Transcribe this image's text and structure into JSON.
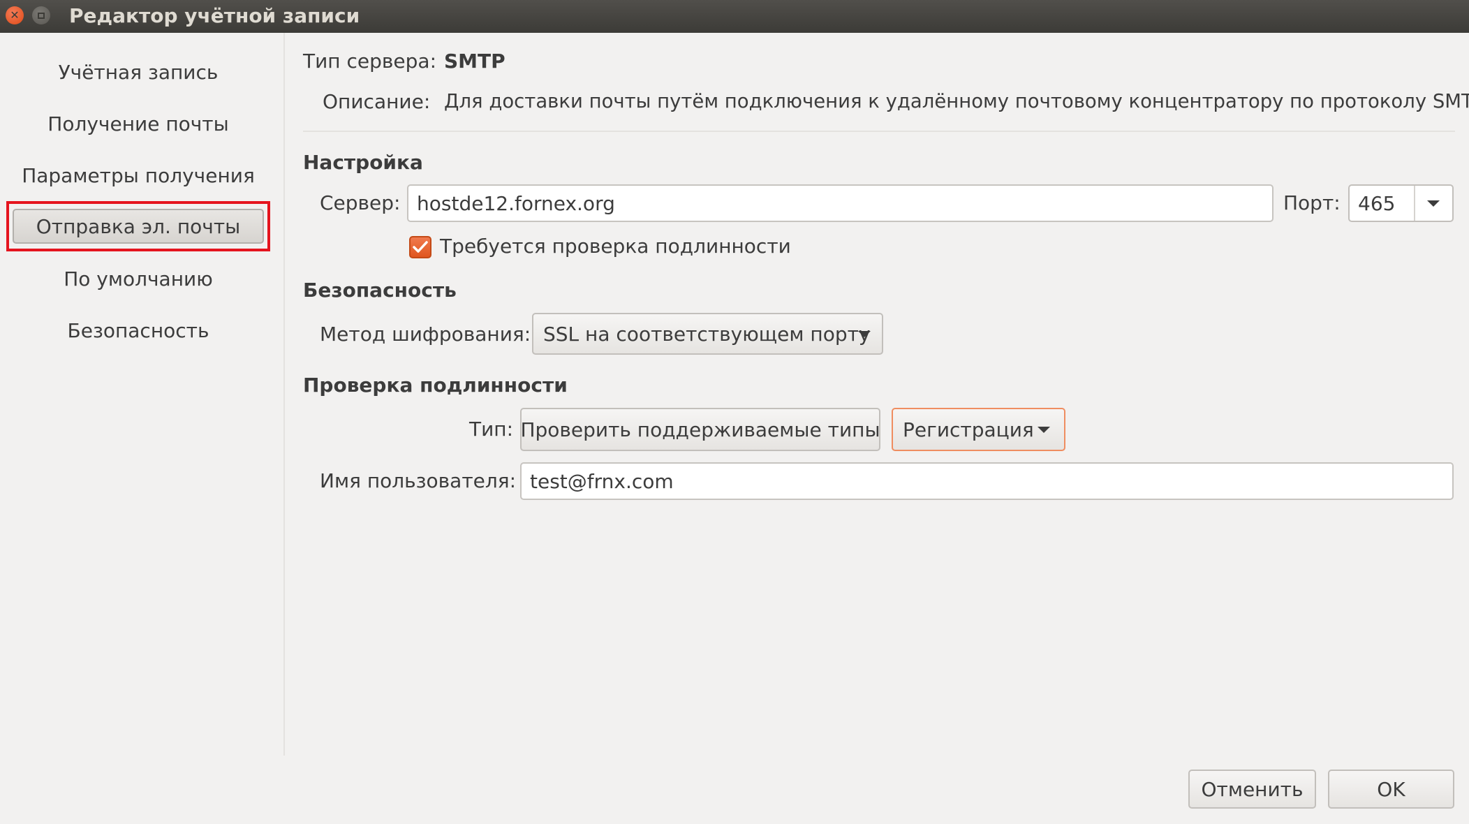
{
  "window": {
    "title": "Редактор учётной записи"
  },
  "sidebar": {
    "items": [
      {
        "label": "Учётная запись"
      },
      {
        "label": "Получение почты"
      },
      {
        "label": "Параметры получения"
      },
      {
        "label": "Отправка эл. почты",
        "selected": true
      },
      {
        "label": "По умолчанию"
      },
      {
        "label": "Безопасность"
      }
    ]
  },
  "server_info": {
    "type_label": "Тип сервера:",
    "type_value": "SMTP",
    "description_label": "Описание:",
    "description_value": "Для доставки почты путём подключения к удалённому почтовому концентратору по протоколу SMTP."
  },
  "settings": {
    "heading": "Настройка",
    "server_label": "Сервер:",
    "server_value": "hostde12.fornex.org",
    "port_label": "Порт:",
    "port_value": "465",
    "auth_required_label": "Требуется проверка подлинности",
    "auth_required_checked": true
  },
  "security": {
    "heading": "Безопасность",
    "encryption_label": "Метод шифрования:",
    "encryption_value": "SSL на соответствующем порту"
  },
  "authentication": {
    "heading": "Проверка подлинности",
    "type_label": "Тип:",
    "check_types_button": "Проверить поддерживаемые типы",
    "type_value": "Регистрация",
    "username_label": "Имя пользователя:",
    "username_value": "test@frnx.com"
  },
  "footer": {
    "cancel_label": "Отменить",
    "ok_label": "OK"
  },
  "colors": {
    "accent": "#e0561f",
    "highlight_box": "#e5141e",
    "titlebar": "#3c3b37"
  },
  "icons": {
    "close": "close-icon",
    "maximize": "maximize-icon",
    "check": "check-icon",
    "dropdown": "chevron-down-icon"
  }
}
